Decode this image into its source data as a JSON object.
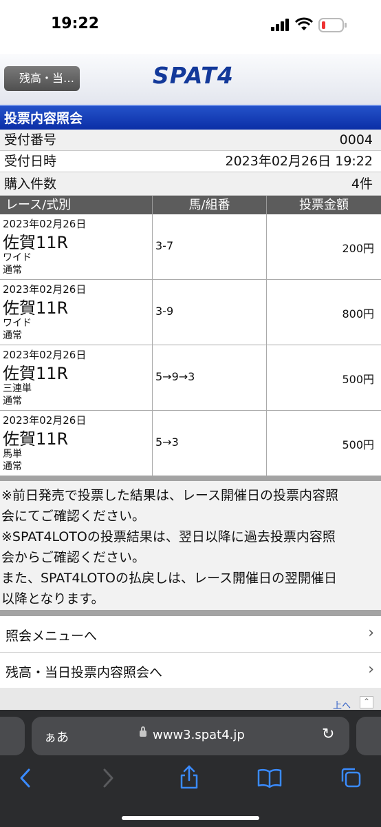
{
  "status_bar": {
    "time": "19:22"
  },
  "header": {
    "back_label": "残高・当…",
    "logo": "SPAT4"
  },
  "section_title": "投票内容照会",
  "info": [
    {
      "label": "受付番号",
      "value": "0004"
    },
    {
      "label": "受付日時",
      "value": "2023年02月26日 19:22"
    },
    {
      "label": "購入件数",
      "value": "4件"
    }
  ],
  "table": {
    "headers": [
      "レース/式別",
      "馬/組番",
      "投票金額"
    ],
    "rows": [
      {
        "date": "2023年02月26日",
        "race": "佐賀11R",
        "bet_type": "ワイド",
        "mode": "通常",
        "combo": "3-7",
        "amount": "200円"
      },
      {
        "date": "2023年02月26日",
        "race": "佐賀11R",
        "bet_type": "ワイド",
        "mode": "通常",
        "combo": "3-9",
        "amount": "800円"
      },
      {
        "date": "2023年02月26日",
        "race": "佐賀11R",
        "bet_type": "三連単",
        "mode": "通常",
        "combo": "5→9→3",
        "amount": "500円"
      },
      {
        "date": "2023年02月26日",
        "race": "佐賀11R",
        "bet_type": "馬単",
        "mode": "通常",
        "combo": "5→3",
        "amount": "500円"
      }
    ]
  },
  "notes": [
    "※前日発売で投票した結果は、レース開催日の投票内容照",
    "会にてご確認ください。",
    "※SPAT4LOTOの投票結果は、翌日以降に過去投票内容照",
    "会からご確認ください。",
    "また、SPAT4LOTOの払戻しは、レース開催日の翌開催日",
    "以降となります。"
  ],
  "menu": [
    {
      "label": "照会メニューへ"
    },
    {
      "label": "残高・当日投票内容照会へ"
    }
  ],
  "page_top_label": "上へ",
  "browser": {
    "text_size": "ぁあ",
    "url": "www3.spat4.jp"
  }
}
